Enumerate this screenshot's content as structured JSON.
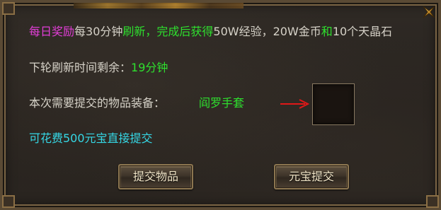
{
  "dialog": {
    "reward_line": {
      "part1": "每日奖励",
      "part2": "每",
      "part3": "30分钟",
      "part4": "刷新，完成后获得",
      "part5": "50W经验，20W金币",
      "part6": "和",
      "part7": "10个天晶石"
    },
    "timer_label": "下轮刷新时间剩余：",
    "timer_value": "19分钟",
    "required_label": "本次需要提交的物品装备：",
    "required_item": "阎罗手套",
    "alt_cost_text": "可花费500元宝直接提交",
    "submit_button_label": "提交物品",
    "yuanbao_button_label": "元宝提交"
  },
  "icons": {
    "close": "close-x-icon",
    "arrow": "right-arrow-icon"
  },
  "colors": {
    "magenta": "#e23ed8",
    "green": "#2ee02e",
    "cyan": "#35d8e6",
    "text": "#d6d2c8",
    "arrow": "#e01818"
  }
}
